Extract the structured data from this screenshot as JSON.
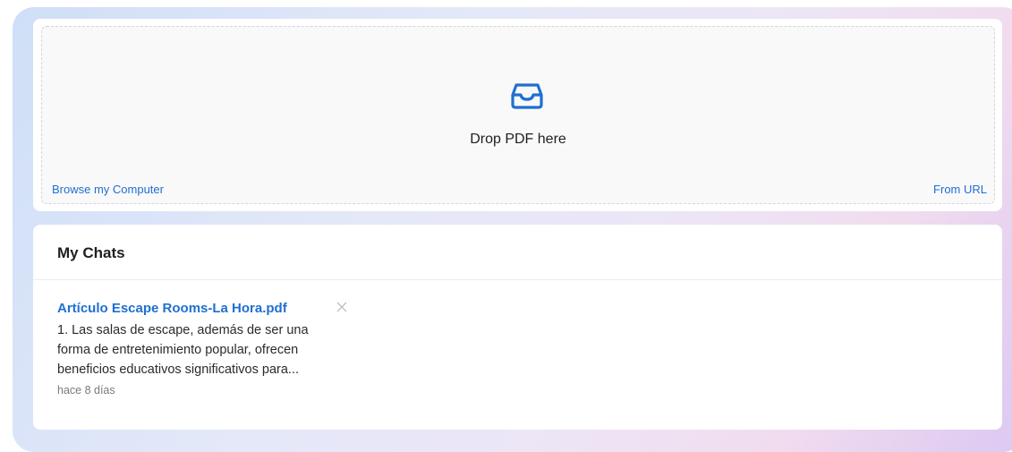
{
  "upload": {
    "icon": "inbox-tray-icon",
    "drop_label": "Drop PDF here",
    "browse_label": "Browse my Computer",
    "url_label": "From URL"
  },
  "chats": {
    "title": "My Chats",
    "items": [
      {
        "title": "Artículo Escape Rooms-La Hora.pdf",
        "snippet_lines": [
          "1. Las salas de escape, además de ser una",
          "forma de entretenimiento popular, ofrecen",
          "beneficios educativos significativos para..."
        ],
        "time": "hace 8 días",
        "close_icon": "close-icon"
      }
    ]
  },
  "colors": {
    "accent": "#1f6fd1",
    "text": "#1f1f1f",
    "muted": "#7a7a7a",
    "dropzone_bg": "#f9f9f9"
  }
}
